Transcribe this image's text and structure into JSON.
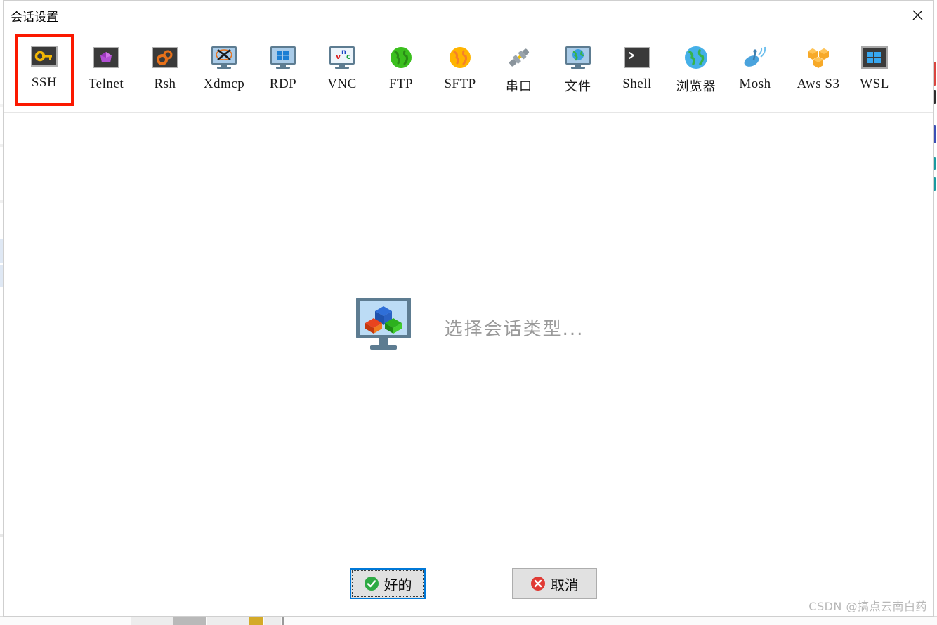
{
  "window": {
    "title": "会话设置",
    "close_icon": "close-icon"
  },
  "session_types": [
    {
      "label": "SSH",
      "icon": "ssh-key-icon",
      "selected": true,
      "cjk": false
    },
    {
      "label": "Telnet",
      "icon": "telnet-gem-icon",
      "selected": false,
      "cjk": false
    },
    {
      "label": "Rsh",
      "icon": "rsh-gears-icon",
      "selected": false,
      "cjk": false
    },
    {
      "label": "Xdmcp",
      "icon": "xdmcp-monitor-icon",
      "selected": false,
      "cjk": false
    },
    {
      "label": "RDP",
      "icon": "rdp-windows-monitor-icon",
      "selected": false,
      "cjk": false
    },
    {
      "label": "VNC",
      "icon": "vnc-monitor-icon",
      "selected": false,
      "cjk": false
    },
    {
      "label": "FTP",
      "icon": "ftp-green-globe-icon",
      "selected": false,
      "cjk": false
    },
    {
      "label": "SFTP",
      "icon": "sftp-orange-globe-icon",
      "selected": false,
      "cjk": false
    },
    {
      "label": "串口",
      "icon": "serial-plug-icon",
      "selected": false,
      "cjk": true
    },
    {
      "label": "文件",
      "icon": "file-monitor-globe-icon",
      "selected": false,
      "cjk": true
    },
    {
      "label": "Shell",
      "icon": "shell-terminal-icon",
      "selected": false,
      "cjk": false
    },
    {
      "label": "浏览器",
      "icon": "browser-globe-icon",
      "selected": false,
      "cjk": true
    },
    {
      "label": "Mosh",
      "icon": "mosh-satellite-icon",
      "selected": false,
      "cjk": false
    },
    {
      "label": "Aws S3",
      "icon": "aws-s3-cubes-icon",
      "selected": false,
      "cjk": false
    },
    {
      "label": "WSL",
      "icon": "wsl-windows-icon",
      "selected": false,
      "cjk": false
    }
  ],
  "center": {
    "icon": "monitor-cubes-icon",
    "text": "选择会话类型..."
  },
  "footer": {
    "ok_label": "好的",
    "ok_icon": "green-check-icon",
    "cancel_label": "取消",
    "cancel_icon": "red-x-icon"
  },
  "watermark": {
    "text": "CSDN @搞点云南白药"
  },
  "colors": {
    "selection_highlight": "#fb1800",
    "focus_border": "#0078d7",
    "ok_green": "#2eaa44",
    "cancel_red": "#e03b35",
    "button_face": "#e1e1e1",
    "placeholder_text": "#9a9a9a",
    "watermark_text": "#b7b7b7"
  }
}
